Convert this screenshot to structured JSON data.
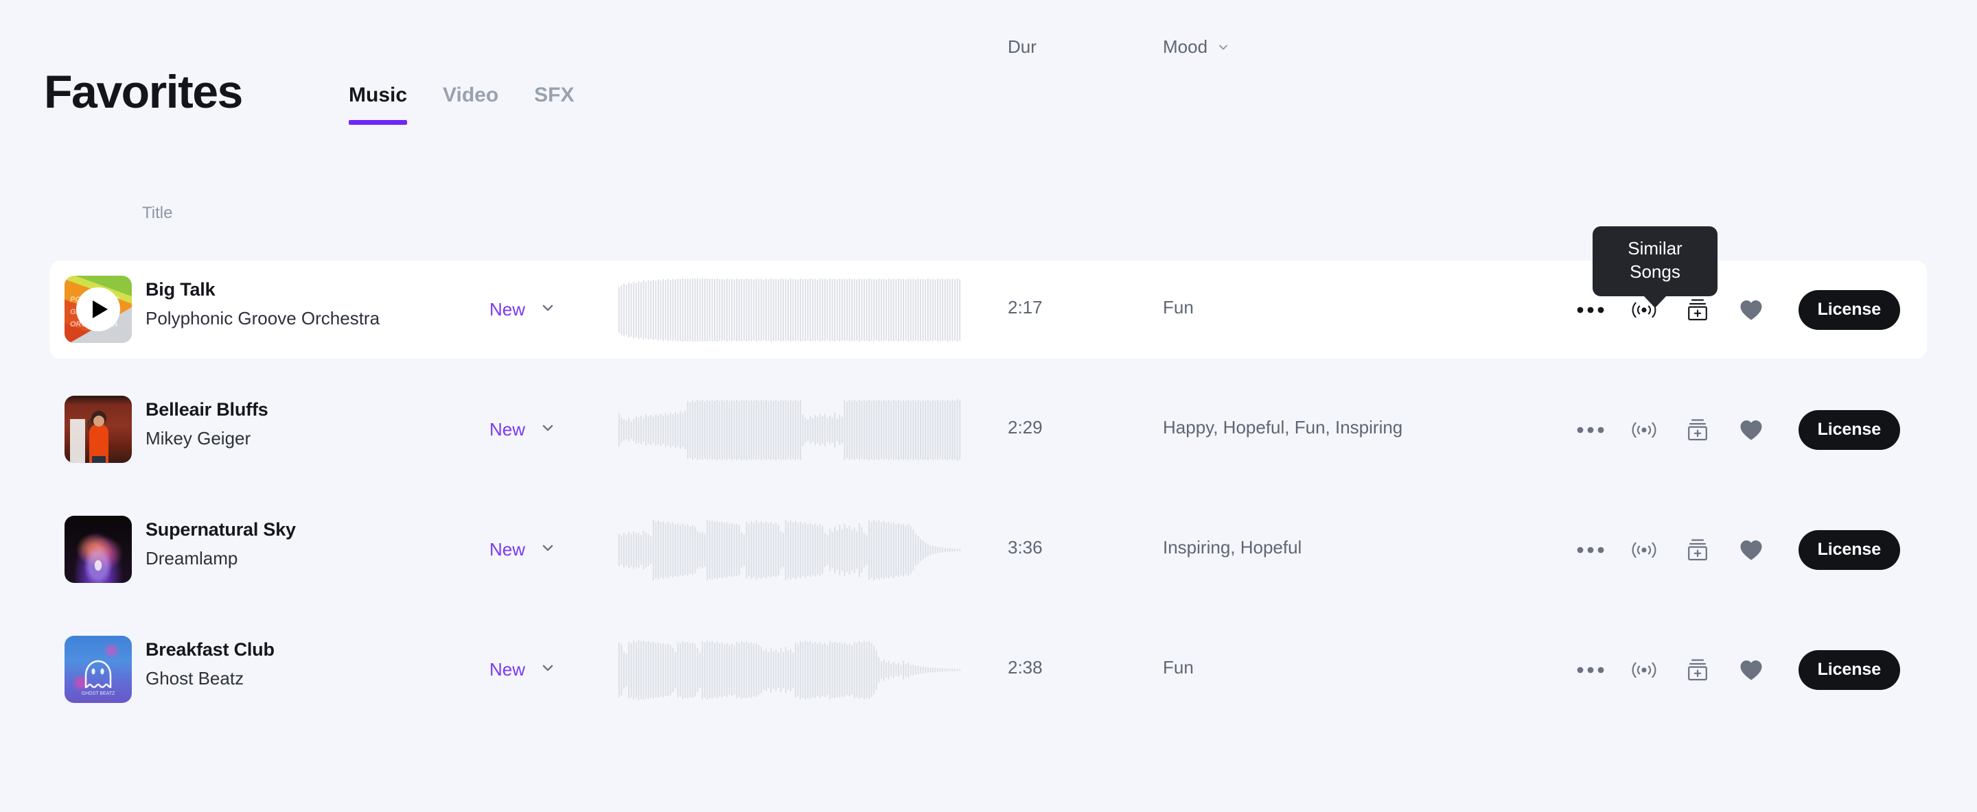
{
  "header": {
    "title": "Favorites",
    "tabs": [
      {
        "label": "Music",
        "active": true
      },
      {
        "label": "Video",
        "active": false
      },
      {
        "label": "SFX",
        "active": false
      }
    ],
    "accent_color": "#6f26f7"
  },
  "columns": {
    "title": "Title",
    "duration": "Dur",
    "mood": "Mood",
    "mood_sort_icon": "chevron-down-icon"
  },
  "tooltip": {
    "line1": "Similar",
    "line2": "Songs",
    "attached_to": "similar-songs-icon",
    "row_index": 0,
    "background": "#24262b"
  },
  "actions": {
    "more_icon": "more-horizontal-icon",
    "similar_icon": "similar-songs-icon",
    "add_icon": "add-to-playlist-icon",
    "favorite_icon": "heart-icon",
    "license_label": "License"
  },
  "tracks": [
    {
      "title": "Big Talk",
      "artist": "Polyphonic Groove Orchestra",
      "version": "New",
      "version_icon": "chevron-down-icon",
      "duration": "2:17",
      "mood": "Fun",
      "license_label": "License",
      "hovered": true,
      "favorited": true,
      "artwork": "polyphonic-groove-orchestra-cover",
      "waveform": [
        72,
        78,
        84,
        80,
        88,
        84,
        90,
        86,
        92,
        88,
        94,
        90,
        95,
        92,
        96,
        93,
        97,
        94,
        98,
        95,
        99,
        96,
        99,
        97,
        100,
        98,
        100,
        99,
        100,
        99,
        100,
        100,
        100,
        99,
        100,
        99,
        100,
        98,
        100,
        99,
        100,
        98,
        99,
        97,
        100,
        98,
        99,
        97,
        100,
        98,
        99,
        97,
        100,
        98,
        99,
        97,
        100,
        98,
        99,
        96,
        99,
        97,
        100,
        98,
        99,
        97,
        100,
        98,
        99,
        97,
        100,
        98,
        99,
        97,
        100,
        98,
        99,
        97,
        100,
        98,
        99,
        96,
        100,
        98,
        99,
        97,
        100,
        98,
        99,
        97,
        100,
        98,
        99,
        97,
        100,
        98,
        99,
        97,
        100,
        98,
        99,
        97,
        100,
        98,
        99,
        97,
        100,
        98,
        99,
        97,
        100,
        98,
        99,
        97,
        100,
        98,
        99,
        97,
        100,
        98,
        99,
        97,
        100,
        98,
        99,
        97,
        100,
        98,
        99,
        96,
        100,
        98,
        99,
        97,
        100,
        98,
        99,
        97,
        100,
        98
      ]
    },
    {
      "title": "Belleair Bluffs",
      "artist": "Mikey Geiger",
      "version": "New",
      "version_icon": "chevron-down-icon",
      "duration": "2:29",
      "mood": "Happy, Hopeful, Fun, Inspiring",
      "license_label": "License",
      "hovered": false,
      "favorited": true,
      "artwork": "mikey-geiger-cover",
      "waveform": [
        54,
        40,
        34,
        30,
        38,
        28,
        36,
        44,
        40,
        46,
        38,
        50,
        44,
        48,
        42,
        50,
        46,
        52,
        44,
        54,
        48,
        56,
        50,
        58,
        52,
        60,
        54,
        62,
        92,
        88,
        94,
        90,
        96,
        92,
        95,
        91,
        96,
        92,
        95,
        93,
        96,
        92,
        95,
        93,
        96,
        92,
        95,
        93,
        96,
        92,
        95,
        93,
        96,
        92,
        95,
        93,
        96,
        92,
        95,
        93,
        96,
        92,
        95,
        93,
        96,
        92,
        95,
        93,
        96,
        92,
        95,
        93,
        96,
        92,
        95,
        50,
        40,
        34,
        44,
        38,
        48,
        42,
        50,
        44,
        52,
        38,
        46,
        40,
        56,
        36,
        48,
        42,
        94,
        90,
        96,
        92,
        95,
        91,
        96,
        92,
        95,
        93,
        96,
        92,
        95,
        93,
        96,
        92,
        95,
        93,
        96,
        92,
        95,
        93,
        96,
        92,
        95,
        93,
        96,
        92,
        95,
        93,
        96,
        92,
        95,
        93,
        96,
        92,
        95,
        93,
        96,
        92,
        95,
        93,
        96,
        92,
        95,
        93,
        98,
        94
      ]
    },
    {
      "title": "Supernatural Sky",
      "artist": "Dreamlamp",
      "version": "New",
      "version_icon": "chevron-down-icon",
      "duration": "3:36",
      "mood": "Inspiring, Hopeful",
      "license_label": "License",
      "hovered": false,
      "favorited": true,
      "artwork": "dreamlamp-cover",
      "waveform": [
        52,
        46,
        56,
        50,
        58,
        52,
        60,
        54,
        56,
        48,
        62,
        56,
        50,
        44,
        96,
        90,
        94,
        88,
        92,
        86,
        90,
        84,
        88,
        82,
        86,
        80,
        84,
        78,
        82,
        76,
        80,
        74,
        60,
        54,
        58,
        52,
        96,
        92,
        94,
        90,
        92,
        88,
        90,
        86,
        88,
        84,
        86,
        82,
        84,
        80,
        56,
        50,
        90,
        84,
        92,
        86,
        94,
        88,
        92,
        86,
        90,
        84,
        88,
        82,
        86,
        80,
        60,
        54,
        96,
        90,
        94,
        88,
        92,
        86,
        90,
        84,
        88,
        82,
        86,
        80,
        84,
        78,
        82,
        76,
        54,
        48,
        68,
        58,
        74,
        62,
        80,
        66,
        84,
        70,
        78,
        64,
        72,
        60,
        86,
        72,
        54,
        48,
        94,
        88,
        96,
        90,
        94,
        88,
        92,
        86,
        90,
        84,
        88,
        82,
        86,
        80,
        84,
        78,
        82,
        76,
        66,
        50,
        44,
        36,
        30,
        24,
        20,
        16,
        14,
        12,
        10,
        9,
        8,
        7,
        6,
        6,
        5,
        5,
        4,
        4
      ]
    },
    {
      "title": "Breakfast Club",
      "artist": "Ghost Beatz",
      "version": "New",
      "version_icon": "chevron-down-icon",
      "duration": "2:38",
      "mood": "Fun",
      "license_label": "License",
      "hovered": false,
      "favorited": true,
      "artwork": "ghost-beatz-cover",
      "waveform": [
        88,
        82,
        60,
        52,
        90,
        86,
        94,
        90,
        96,
        92,
        94,
        90,
        92,
        88,
        90,
        86,
        88,
        84,
        86,
        82,
        84,
        80,
        70,
        58,
        88,
        84,
        92,
        88,
        90,
        86,
        88,
        84,
        70,
        56,
        92,
        88,
        94,
        90,
        92,
        86,
        90,
        84,
        88,
        82,
        86,
        80,
        84,
        78,
        90,
        86,
        92,
        88,
        90,
        86,
        88,
        84,
        86,
        80,
        74,
        62,
        68,
        58,
        72,
        60,
        66,
        56,
        70,
        58,
        74,
        62,
        68,
        56,
        88,
        84,
        92,
        88,
        94,
        90,
        92,
        86,
        90,
        84,
        88,
        82,
        86,
        80,
        92,
        88,
        90,
        86,
        88,
        84,
        86,
        80,
        84,
        78,
        90,
        86,
        92,
        88,
        94,
        90,
        92,
        86,
        78,
        62,
        40,
        28,
        34,
        24,
        30,
        20,
        26,
        18,
        22,
        16,
        30,
        20,
        24,
        16,
        18,
        14,
        14,
        11,
        11,
        9,
        9,
        8,
        8,
        7,
        7,
        6,
        6,
        5,
        5,
        4,
        4,
        4,
        3,
        3
      ]
    }
  ],
  "colors": {
    "page_background": "#f4f6fb",
    "row_hover_background": "#ffffff",
    "waveform_bar": "#dcdfe6",
    "license_button": "#111317",
    "version_text": "#7b38f5",
    "muted_text": "#5e6573"
  }
}
